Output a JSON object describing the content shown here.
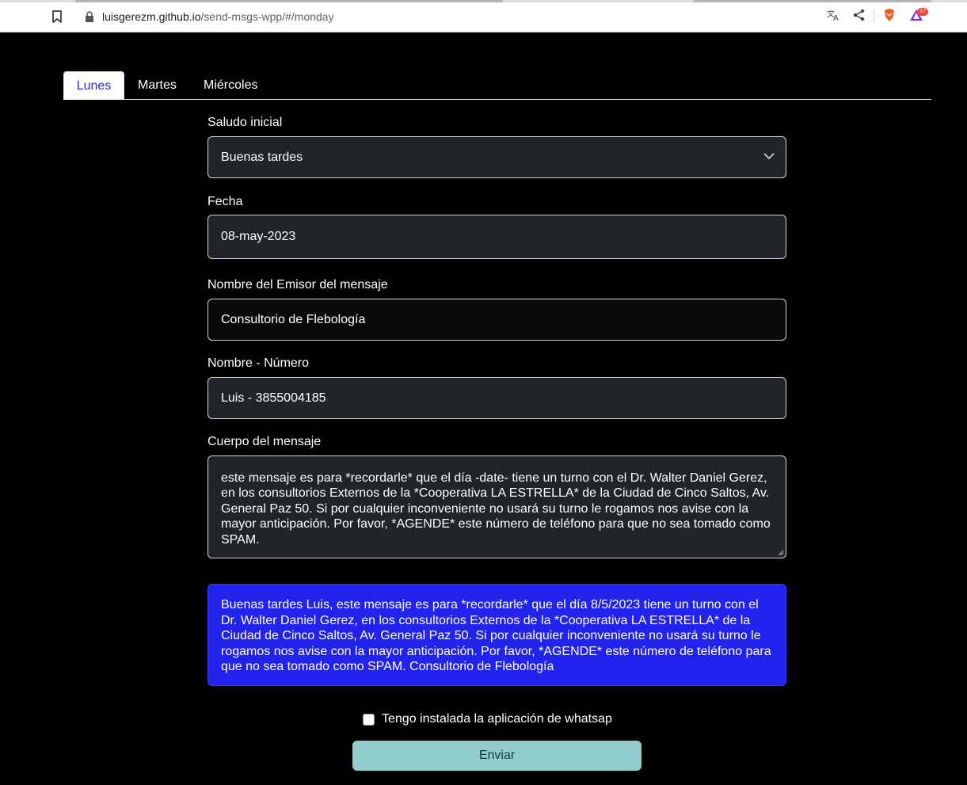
{
  "browser": {
    "url_host": "luisgerezm.github.io",
    "url_path": "/send-msgs-wpp/#/monday",
    "notification_count": "17"
  },
  "tabs": [
    {
      "label": "Lunes",
      "active": true
    },
    {
      "label": "Martes",
      "active": false
    },
    {
      "label": "Miércoles",
      "active": false
    }
  ],
  "form": {
    "greeting_label": "Saludo inicial",
    "greeting_value": "Buenas tardes",
    "date_label": "Fecha",
    "date_value": "08-may-2023",
    "sender_label": "Nombre del Emisor del mensaje",
    "sender_value": "Consultorio de Flebología",
    "contact_label": "Nombre - Número",
    "contact_value": "Luis - 3855004185",
    "body_label": "Cuerpo del mensaje",
    "body_value": "este mensaje es para *recordarle* que el día -date- tiene un turno con el Dr. Walter Daniel Gerez, en los consultorios Externos de la *Cooperativa LA ESTRELLA* de la Ciudad de Cinco Saltos, Av. General Paz 50. Si por cualquier inconveniente no usará su turno le rogamos nos avise con la mayor anticipación. Por favor, *AGENDE* este número de teléfono para que no sea tomado como SPAM."
  },
  "preview": {
    "text": "Buenas tardes Luis, este mensaje es para *recordarle* que el día 8/5/2023 tiene un turno con el Dr. Walter Daniel Gerez, en los consultorios Externos de la *Cooperativa LA ESTRELLA* de la Ciudad de Cinco Saltos, Av. General Paz 50. Si por cualquier inconveniente no usará su turno le rogamos nos avise con la mayor anticipación. Por favor, *AGENDE* este número de teléfono para que no sea tomado como SPAM. Consultorio de Flebología"
  },
  "whatsapp_checkbox": {
    "label": "Tengo instalada la aplicación de whatsap",
    "checked": false
  },
  "send_button": {
    "label": "Enviar"
  },
  "colors": {
    "preview_bg": "#2323ee",
    "send_bg": "#8fcccb",
    "active_tab_text": "#2b2bcc"
  }
}
